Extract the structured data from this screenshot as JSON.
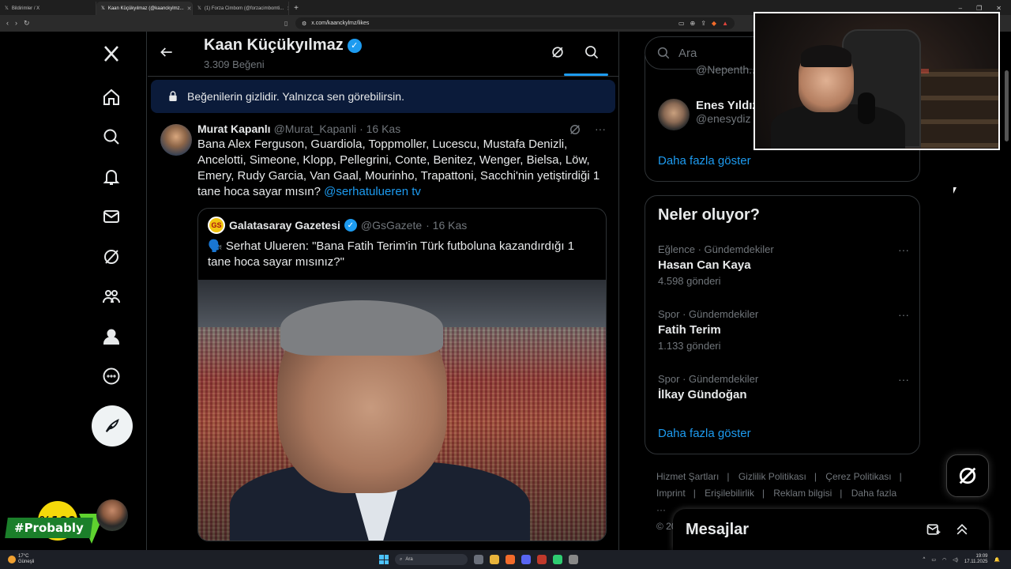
{
  "browser": {
    "tabs": [
      {
        "title": "Bildirimler / X",
        "active": false
      },
      {
        "title": "Kaan Küçükyılmaz (@kaanckylmz...",
        "active": true
      },
      {
        "title": "(1) Forza Cimbom (@forzacimbomti...",
        "active": false
      }
    ],
    "url": "x.com/kaanckylmz/likes"
  },
  "profile": {
    "name": "Kaan Küçükyılmaz",
    "likes_count": "3.309 Beğeni"
  },
  "privacy_notice": "Beğenilerin gizlidir. Yalnızca sen görebilirsin.",
  "tweet": {
    "author_name": "Murat Kapanlı",
    "author_handle": "@Murat_Kapanli",
    "date": "· 16 Kas",
    "text": "Bana Alex Ferguson, Guardiola, Toppmoller, Lucescu, Mustafa Denizli, Ancelotti, Simeone, Klopp, Pellegrini, Conte, Benitez, Wenger, Bielsa, Löw, Emery, Rudy Garcia, Van Gaal, Mourinho, Trapattoni, Sacchi'nin yetiştirdiği 1 tane hoca sayar mısın?",
    "mention": "@serhatulueren tv",
    "more": "···",
    "quote": {
      "author_name": "Galatasaray Gazetesi",
      "author_handle": "@GsGazete",
      "date": "· 16 Kas",
      "text": "🗣️ Serhat Ulueren: \"Bana Fatih Terim'in Türk futboluna kazandırdığı 1 tane hoca sayar mısınız?\""
    }
  },
  "search": {
    "placeholder": "Ara"
  },
  "who_to_follow": {
    "partial_handle": "@Nepenth...",
    "user_name": "Enes Yıldız",
    "user_handle": "@enesydiz",
    "show_more": "Daha fazla göster"
  },
  "trends": {
    "title": "Neler oluyor?",
    "items": [
      {
        "category": "Eğlence · Gündemdekiler",
        "name": "Hasan Can Kaya",
        "count": "4.598 gönderi"
      },
      {
        "category": "Spor · Gündemdekiler",
        "name": "Fatih Terim",
        "count": "1.133 gönderi"
      },
      {
        "category": "Spor · Gündemdekiler",
        "name": "İlkay Gündoğan",
        "count": ""
      }
    ],
    "show_more": "Daha fazla göster",
    "dots": "···"
  },
  "footer": {
    "links": [
      "Hizmet Şartları",
      "Gizlilik Politikası",
      "Çerez Politikası",
      "Imprint",
      "Erişilebilirlik",
      "Reklam bilgisi",
      "Daha fazla ···"
    ],
    "copyright": "© 20"
  },
  "messages": {
    "label": "Mesajlar"
  },
  "overlay": {
    "badge": "%100",
    "hashtag": "#Probably"
  },
  "taskbar": {
    "temperature": "17°C",
    "weather": "Güneşli",
    "search": "Ara",
    "time": "19:09",
    "date": "17.11.2025"
  }
}
